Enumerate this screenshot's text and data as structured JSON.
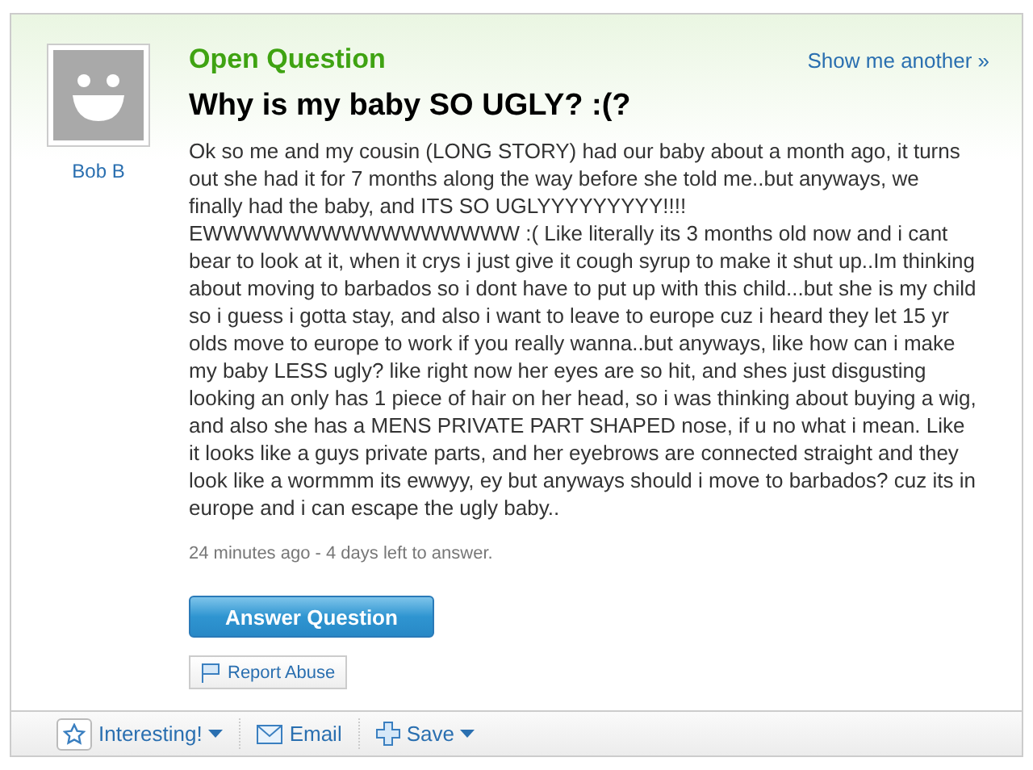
{
  "asker": {
    "name": "Bob B"
  },
  "header": {
    "status": "Open Question",
    "show_another": "Show me another »"
  },
  "question": {
    "title": "Why is my baby SO UGLY? :(?",
    "body": "Ok so me and my cousin (LONG STORY) had our baby about a month ago, it turns out she had it for 7 months along the way before she told me..but anyways, we finally had the baby, and ITS SO UGLYYYYYYYYY!!!! EWWWWWWWWWWWWWWWW :( Like literally its 3 months old now and i cant bear to look at it, when it crys i just give it cough syrup to make it shut up..Im thinking about moving to barbados so i dont have to put up with this child...but she is my child so i guess i gotta stay, and also i want to leave to europe cuz i heard they let 15 yr olds move to europe to work if you really wanna..but anyways, like how can i make my baby LESS ugly? like right now her eyes are so hit, and shes just disgusting looking an only has 1 piece of hair on her head, so i was thinking about buying a wig, and also she has a MENS PRIVATE PART SHAPED nose, if u no what i mean. Like it looks like a guys private parts, and her eyebrows are connected straight and they look like a wormmm its ewwyy, ey but anyways should i move to barbados? cuz its in europe and i can escape the ugly baby..",
    "meta": "24 minutes ago - 4 days left to answer."
  },
  "actions": {
    "answer": "Answer Question",
    "report": "Report Abuse"
  },
  "toolbar": [
    {
      "kind": "interesting",
      "label": "Interesting!",
      "dropdown": true
    },
    {
      "kind": "email",
      "label": "Email",
      "dropdown": false
    },
    {
      "kind": "save",
      "label": "Save",
      "dropdown": true
    }
  ]
}
